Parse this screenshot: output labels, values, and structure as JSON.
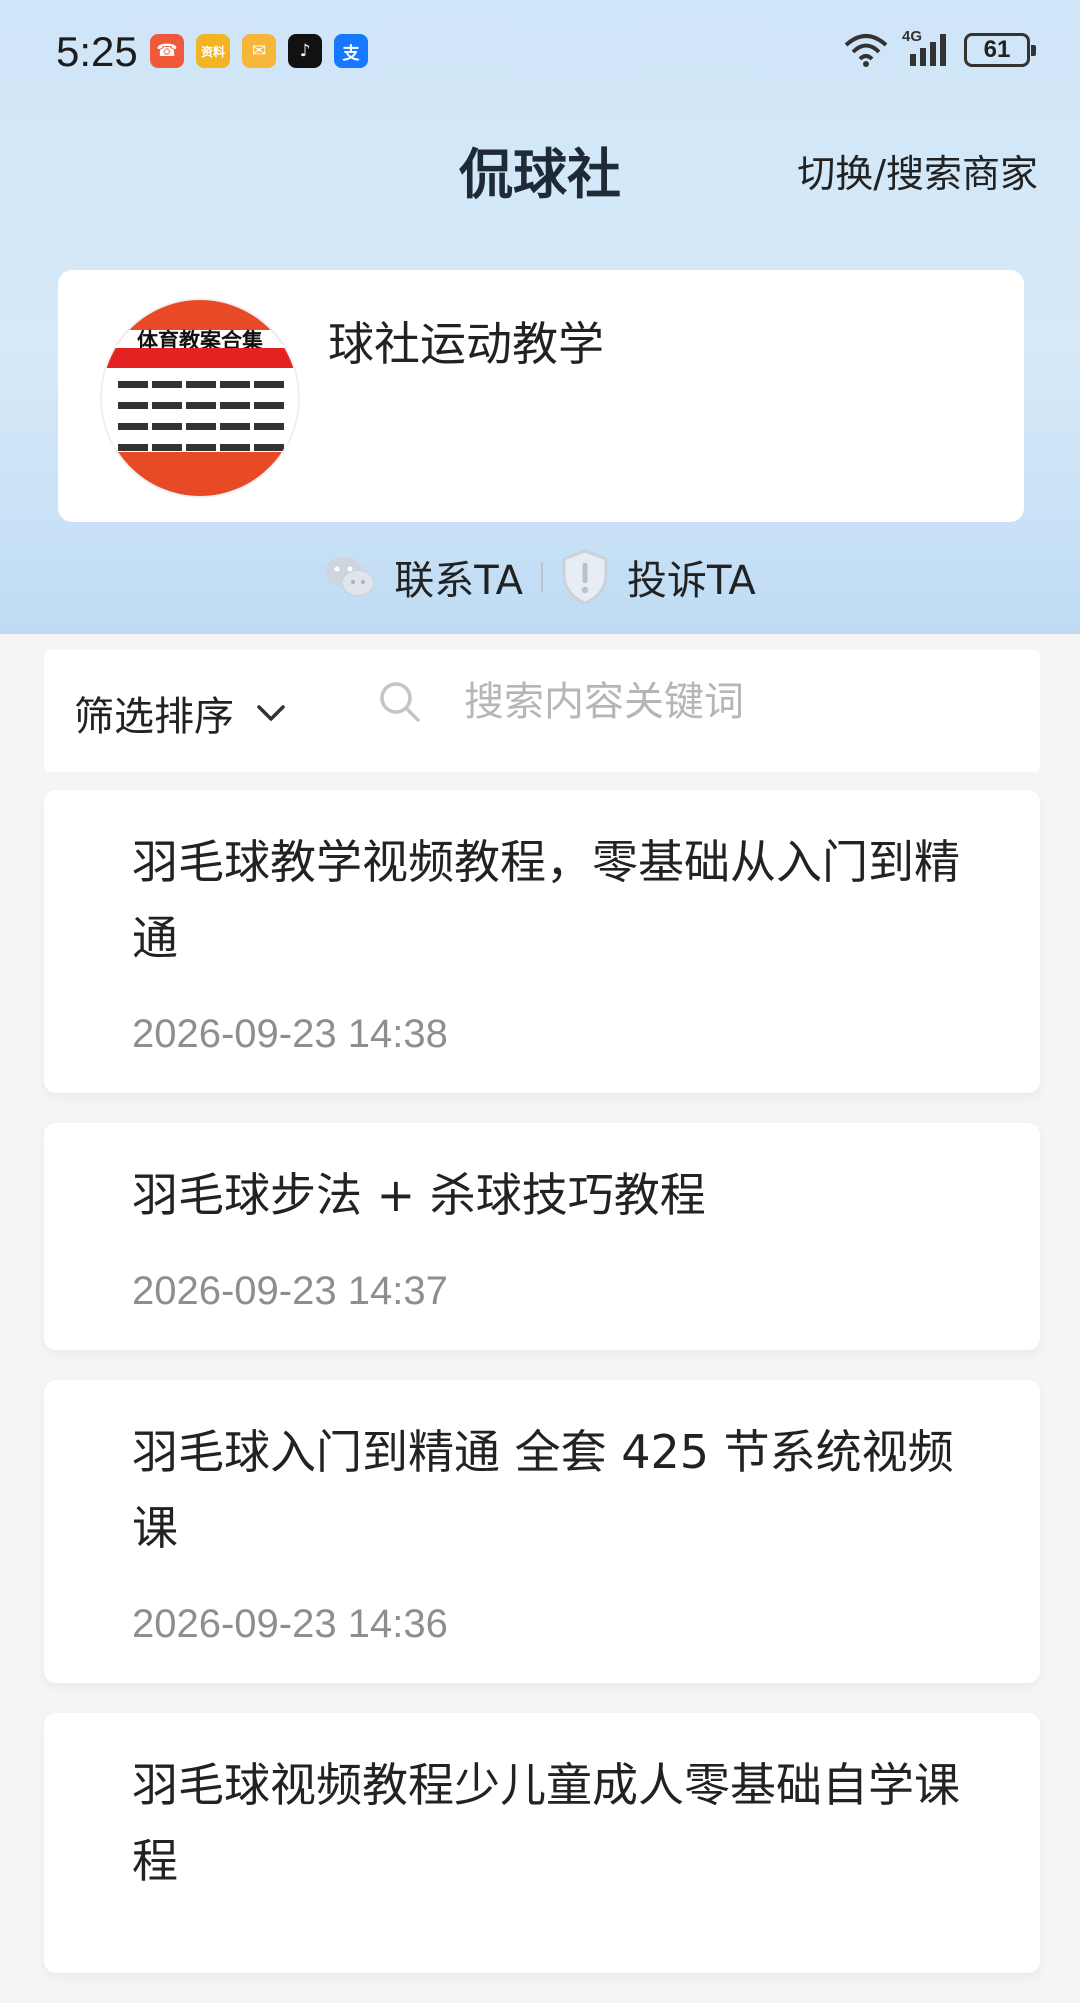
{
  "status_bar": {
    "time": "5:25",
    "app_icons": [
      {
        "name": "missed-call-icon",
        "glyph": "☎",
        "color": "#f05a3a"
      },
      {
        "name": "ziliao-app-icon",
        "glyph": "资料",
        "color": "#f2b425"
      },
      {
        "name": "mail-app-icon",
        "glyph": "✉",
        "color": "#f6b63a"
      },
      {
        "name": "tiktok-app-icon",
        "glyph": "♪",
        "color": "#111111"
      },
      {
        "name": "alipay-app-icon",
        "glyph": "支",
        "color": "#1677ff"
      }
    ],
    "network": "4G",
    "battery": "61"
  },
  "header": {
    "title": "侃球社",
    "switch_label": "切换/搜索商家"
  },
  "profile": {
    "avatar_text": "体育教案合集",
    "name": "球社运动教学"
  },
  "actions": {
    "contact_label": "联系TA",
    "complain_label": "投诉TA"
  },
  "filter": {
    "sort_label": "筛选排序",
    "search_placeholder": "搜索内容关键词"
  },
  "items": [
    {
      "title": "羽毛球教学视频教程，零基础从入门到精通",
      "time": "2026-09-23 14:38"
    },
    {
      "title": "羽毛球步法 + 杀球技巧教程",
      "time": "2026-09-23 14:37"
    },
    {
      "title": "羽毛球入门到精通 全套 425 节系统视频课",
      "time": "2026-09-23 14:36"
    },
    {
      "title": "羽毛球视频教程少儿童成人零基础自学课程",
      "time": ""
    }
  ],
  "colors": {
    "hero_bg": "#cfe6f8",
    "text_primary": "#222222",
    "text_secondary": "#8e8e8e",
    "placeholder": "#b6b6b6"
  }
}
